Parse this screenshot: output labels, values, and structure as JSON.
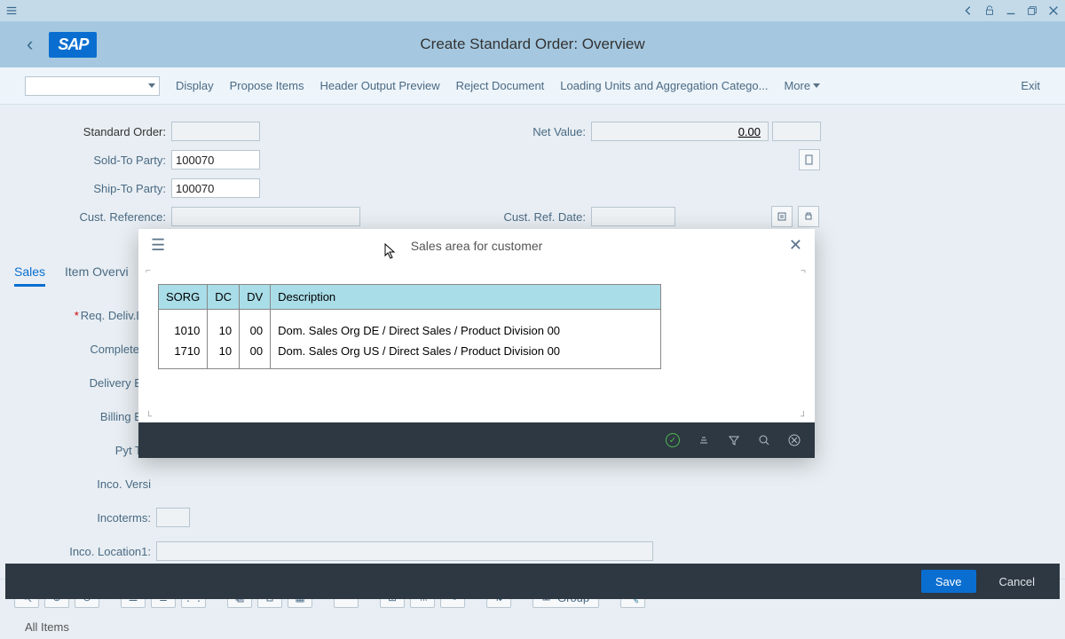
{
  "page_title": "Create Standard Order: Overview",
  "toolbar": {
    "display": "Display",
    "propose_items": "Propose Items",
    "header_output_preview": "Header Output Preview",
    "reject_document": "Reject Document",
    "loading_units": "Loading Units and Aggregation Catego...",
    "more": "More",
    "exit": "Exit"
  },
  "form": {
    "standard_order_label": "Standard Order:",
    "standard_order_value": "",
    "net_value_label": "Net Value:",
    "net_value": "0.00",
    "sold_to_label": "Sold-To Party:",
    "sold_to_value": "100070",
    "ship_to_label": "Ship-To Party:",
    "ship_to_value": "100070",
    "cust_ref_label": "Cust. Reference:",
    "cust_ref_value": "",
    "cust_ref_date_label": "Cust. Ref. Date:",
    "cust_ref_date_value": ""
  },
  "tabs": {
    "sales": "Sales",
    "item_overview": "Item Overvi"
  },
  "sales_form": {
    "req_deliv_date": "Req. Deliv.Da",
    "complete_d": "Complete D",
    "delivery_blo": "Delivery Blo",
    "billing_blo": "Billing Blo",
    "pyt_ter": "Pyt Ter",
    "inco_versi": "Inco. Versi",
    "incoterms": "Incoterms:",
    "inco_location1": "Inco. Location1:"
  },
  "bottom_toolbar": {
    "group": "Group"
  },
  "all_items": "All Items",
  "footer": {
    "save": "Save",
    "cancel": "Cancel"
  },
  "dialog": {
    "title": "Sales area for customer",
    "columns": {
      "sorg": "SORG",
      "dc": "DC",
      "dv": "DV",
      "description": "Description"
    },
    "rows": [
      {
        "sorg": "1010",
        "dc": "10",
        "dv": "00",
        "desc": "Dom. Sales Org DE / Direct Sales / Product Division 00"
      },
      {
        "sorg": "1710",
        "dc": "10",
        "dv": "00",
        "desc": "Dom. Sales Org US / Direct Sales / Product Division 00"
      }
    ]
  }
}
